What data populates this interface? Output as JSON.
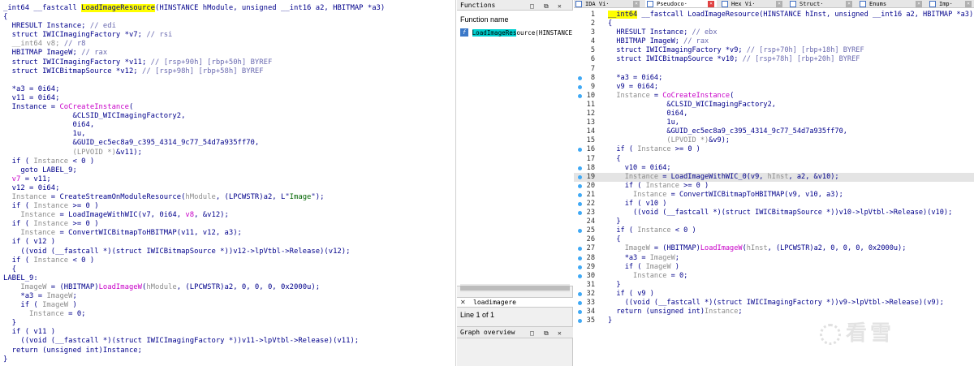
{
  "left": {
    "lines": [
      [
        [
          "kw",
          "_int64 __fastcall "
        ],
        [
          "hl-fn",
          "LoadImageResource"
        ],
        [
          "kw",
          "(HINSTANCE hModule, unsigned __int16 a2, HBITMAP *a3)"
        ]
      ],
      [
        [
          "kw",
          "{"
        ]
      ],
      [
        [
          "kw",
          "  HRESULT Instance; "
        ],
        [
          "cm",
          "// edi"
        ]
      ],
      [
        [
          "kw",
          "  struct IWICImagingFactory *v7; "
        ],
        [
          "cm",
          "// rsi"
        ]
      ],
      [
        [
          "gr",
          "  __int64 v8; "
        ],
        [
          "cm",
          "// r8"
        ]
      ],
      [
        [
          "kw",
          "  HBITMAP ImageW; "
        ],
        [
          "cm",
          "// rax"
        ]
      ],
      [
        [
          "kw",
          "  struct IWICImagingFactory *v11; "
        ],
        [
          "cm",
          "// [rsp+90h] [rbp+50h] BYREF"
        ]
      ],
      [
        [
          "kw",
          "  struct IWICBitmapSource *v12; "
        ],
        [
          "cm",
          "// [rsp+98h] [rbp+58h] BYREF"
        ]
      ],
      [
        [
          "kw",
          ""
        ]
      ],
      [
        [
          "kw",
          "  *a3 = 0i64;"
        ]
      ],
      [
        [
          "kw",
          "  v11 = 0i64;"
        ]
      ],
      [
        [
          "kw",
          "  Instance = "
        ],
        [
          "mg",
          "CoCreateInstance"
        ],
        [
          "kw",
          "("
        ]
      ],
      [
        [
          "kw",
          "                &CLSID_WICImagingFactory2,"
        ]
      ],
      [
        [
          "kw",
          "                0i64,"
        ]
      ],
      [
        [
          "kw",
          "                1u,"
        ]
      ],
      [
        [
          "kw",
          "                &GUID_ec5ec8a9_c395_4314_9c77_54d7a935ff70,"
        ]
      ],
      [
        [
          "gr",
          "                (LPVOID *)"
        ],
        [
          "kw",
          "&v11);"
        ]
      ],
      [
        [
          "kw",
          "  if ( "
        ],
        [
          "gr",
          "Instance"
        ],
        [
          "kw",
          " < 0 )"
        ]
      ],
      [
        [
          "kw",
          "    goto LABEL_9;"
        ]
      ],
      [
        [
          "mg",
          "  v7"
        ],
        [
          "kw",
          " = v11;"
        ]
      ],
      [
        [
          "kw",
          "  v12 = 0i64;"
        ]
      ],
      [
        [
          "gr",
          "  Instance"
        ],
        [
          "kw",
          " = CreateStreamOnModuleResource("
        ],
        [
          "gr",
          "hModule"
        ],
        [
          "kw",
          ", (LPCWSTR)a2, L\""
        ],
        [
          "gn",
          "Image"
        ],
        [
          "kw",
          "\");"
        ]
      ],
      [
        [
          "kw",
          "  if ( "
        ],
        [
          "gr",
          "Instance"
        ],
        [
          "kw",
          " >= 0 )"
        ]
      ],
      [
        [
          "gr",
          "    Instance"
        ],
        [
          "kw",
          " = LoadImageWithWIC(v7, 0i64, "
        ],
        [
          "mg",
          "v8"
        ],
        [
          "kw",
          ", &v12);"
        ]
      ],
      [
        [
          "kw",
          "  if ( "
        ],
        [
          "gr",
          "Instance"
        ],
        [
          "kw",
          " >= 0 )"
        ]
      ],
      [
        [
          "gr",
          "    Instance"
        ],
        [
          "kw",
          " = ConvertWICBitmapToHBITMAP(v11, v12, a3);"
        ]
      ],
      [
        [
          "kw",
          "  if ( v12 )"
        ]
      ],
      [
        [
          "kw",
          "    ((void (__fastcall *)(struct IWICBitmapSource *))v12->lpVtbl->Release)(v12);"
        ]
      ],
      [
        [
          "kw",
          "  if ( "
        ],
        [
          "gr",
          "Instance"
        ],
        [
          "kw",
          " < 0 )"
        ]
      ],
      [
        [
          "kw",
          "  {"
        ]
      ],
      [
        [
          "kw",
          "LABEL_9:"
        ]
      ],
      [
        [
          "gr",
          "    ImageW"
        ],
        [
          "kw",
          " = (HBITMAP)"
        ],
        [
          "mg",
          "LoadImageW"
        ],
        [
          "kw",
          "("
        ],
        [
          "gr",
          "hModule"
        ],
        [
          "kw",
          ", (LPCWSTR)a2, 0, 0, 0, 0x2000u);"
        ]
      ],
      [
        [
          "kw",
          "    *a3 = "
        ],
        [
          "gr",
          "ImageW"
        ],
        [
          "kw",
          ";"
        ]
      ],
      [
        [
          "kw",
          "    if ( "
        ],
        [
          "gr",
          "ImageW"
        ],
        [
          "kw",
          " )"
        ]
      ],
      [
        [
          "gr",
          "      Instance"
        ],
        [
          "kw",
          " = 0;"
        ]
      ],
      [
        [
          "kw",
          "  }"
        ]
      ],
      [
        [
          "kw",
          "  if ( v11 )"
        ]
      ],
      [
        [
          "kw",
          "    ((void (__fastcall *)(struct IWICImagingFactory *))v11->lpVtbl->Release)(v11);"
        ]
      ],
      [
        [
          "kw",
          "  return (unsigned int)Instance;"
        ]
      ],
      [
        [
          "kw",
          "}"
        ]
      ]
    ]
  },
  "middle": {
    "functions_title": "Functions",
    "column_header": "Function name",
    "function_item": "LoadImageResource(HINSTANCE",
    "function_hl": "LoadImageRes",
    "function_rest": "ource(HINSTANCE",
    "function_icon": "f",
    "search_value": "loadimagere",
    "search_clear": "✕",
    "line_info": "Line 1 of 1",
    "graph_title": "Graph overview"
  },
  "tabs": [
    {
      "label": "IDA Vi·",
      "active": false
    },
    {
      "label": "Pseudoco·",
      "active": true
    },
    {
      "label": "Hex Vi·",
      "active": false
    },
    {
      "label": "Struct·",
      "active": false
    },
    {
      "label": "Enums",
      "active": false
    },
    {
      "label": "Imp·",
      "active": false
    }
  ],
  "right": {
    "rows": [
      {
        "n": "1",
        "dot": false,
        "hl": false,
        "seg": [
          [
            "hl-fn",
            "__int64"
          ],
          [
            "kw",
            " __fastcall LoadImageResource(HINSTANCE hInst, unsigned __int16 a2, HBITMAP *a3)"
          ]
        ]
      },
      {
        "n": "2",
        "dot": false,
        "hl": false,
        "seg": [
          [
            "kw",
            "{"
          ]
        ]
      },
      {
        "n": "3",
        "dot": false,
        "hl": false,
        "seg": [
          [
            "kw",
            "  HRESULT Instance; "
          ],
          [
            "cm",
            "// ebx"
          ]
        ]
      },
      {
        "n": "4",
        "dot": false,
        "hl": false,
        "seg": [
          [
            "kw",
            "  HBITMAP ImageW; "
          ],
          [
            "cm",
            "// rax"
          ]
        ]
      },
      {
        "n": "5",
        "dot": false,
        "hl": false,
        "seg": [
          [
            "kw",
            "  struct IWICImagingFactory *v9; "
          ],
          [
            "cm",
            "// [rsp+70h] [rbp+18h] BYREF"
          ]
        ]
      },
      {
        "n": "6",
        "dot": false,
        "hl": false,
        "seg": [
          [
            "kw",
            "  struct IWICBitmapSource *v10; "
          ],
          [
            "cm",
            "// [rsp+78h] [rbp+20h] BYREF"
          ]
        ]
      },
      {
        "n": "7",
        "dot": false,
        "hl": false,
        "seg": [
          [
            "kw",
            ""
          ]
        ]
      },
      {
        "n": "8",
        "dot": true,
        "hl": false,
        "seg": [
          [
            "kw",
            "  *a3 = 0i64;"
          ]
        ]
      },
      {
        "n": "9",
        "dot": true,
        "hl": false,
        "seg": [
          [
            "kw",
            "  v9 = 0i64;"
          ]
        ]
      },
      {
        "n": "10",
        "dot": true,
        "hl": false,
        "seg": [
          [
            "gr",
            "  Instance"
          ],
          [
            "kw",
            " = "
          ],
          [
            "mg",
            "CoCreateInstance"
          ],
          [
            "kw",
            "("
          ]
        ]
      },
      {
        "n": "11",
        "dot": false,
        "hl": false,
        "seg": [
          [
            "kw",
            "              &CLSID_WICImagingFactory2,"
          ]
        ]
      },
      {
        "n": "12",
        "dot": false,
        "hl": false,
        "seg": [
          [
            "kw",
            "              0i64,"
          ]
        ]
      },
      {
        "n": "13",
        "dot": false,
        "hl": false,
        "seg": [
          [
            "kw",
            "              1u,"
          ]
        ]
      },
      {
        "n": "14",
        "dot": false,
        "hl": false,
        "seg": [
          [
            "kw",
            "              &GUID_ec5ec8a9_c395_4314_9c77_54d7a935ff70,"
          ]
        ]
      },
      {
        "n": "15",
        "dot": false,
        "hl": false,
        "seg": [
          [
            "gr",
            "              (LPVOID *)"
          ],
          [
            "kw",
            "&v9);"
          ]
        ]
      },
      {
        "n": "16",
        "dot": true,
        "hl": false,
        "seg": [
          [
            "kw",
            "  if ( "
          ],
          [
            "gr",
            "Instance"
          ],
          [
            "kw",
            " >= 0 )"
          ]
        ]
      },
      {
        "n": "17",
        "dot": false,
        "hl": false,
        "seg": [
          [
            "kw",
            "  {"
          ]
        ]
      },
      {
        "n": "18",
        "dot": true,
        "hl": false,
        "seg": [
          [
            "kw",
            "    v10 = 0i64;"
          ]
        ]
      },
      {
        "n": "19",
        "dot": true,
        "hl": true,
        "seg": [
          [
            "gr",
            "    Instance"
          ],
          [
            "kw",
            " = LoadImageWithWIC_0(v9, "
          ],
          [
            "gr",
            "hInst"
          ],
          [
            "kw",
            ", a2, &v10);"
          ]
        ]
      },
      {
        "n": "20",
        "dot": true,
        "hl": false,
        "seg": [
          [
            "kw",
            "    if ( "
          ],
          [
            "gr",
            "Instance"
          ],
          [
            "kw",
            " >= 0 )"
          ]
        ]
      },
      {
        "n": "21",
        "dot": true,
        "hl": false,
        "seg": [
          [
            "gr",
            "      Instance"
          ],
          [
            "kw",
            " = ConvertWICBitmapToHBITMAP(v9, v10, a3);"
          ]
        ]
      },
      {
        "n": "22",
        "dot": true,
        "hl": false,
        "seg": [
          [
            "kw",
            "    if ( v10 )"
          ]
        ]
      },
      {
        "n": "23",
        "dot": true,
        "hl": false,
        "seg": [
          [
            "kw",
            "      ((void (__fastcall *)(struct IWICBitmapSource *))v10->lpVtbl->Release)(v10);"
          ]
        ]
      },
      {
        "n": "24",
        "dot": false,
        "hl": false,
        "seg": [
          [
            "kw",
            "  }"
          ]
        ]
      },
      {
        "n": "25",
        "dot": true,
        "hl": false,
        "seg": [
          [
            "kw",
            "  if ( "
          ],
          [
            "gr",
            "Instance"
          ],
          [
            "kw",
            " < 0 )"
          ]
        ]
      },
      {
        "n": "26",
        "dot": false,
        "hl": false,
        "seg": [
          [
            "kw",
            "  {"
          ]
        ]
      },
      {
        "n": "27",
        "dot": true,
        "hl": false,
        "seg": [
          [
            "gr",
            "    ImageW"
          ],
          [
            "kw",
            " = (HBITMAP)"
          ],
          [
            "mg",
            "LoadImageW"
          ],
          [
            "kw",
            "("
          ],
          [
            "gr",
            "hInst"
          ],
          [
            "kw",
            ", (LPCWSTR)a2, 0, 0, 0, 0x2000u);"
          ]
        ]
      },
      {
        "n": "28",
        "dot": true,
        "hl": false,
        "seg": [
          [
            "kw",
            "    *a3 = "
          ],
          [
            "gr",
            "ImageW"
          ],
          [
            "kw",
            ";"
          ]
        ]
      },
      {
        "n": "29",
        "dot": true,
        "hl": false,
        "seg": [
          [
            "kw",
            "    if ( "
          ],
          [
            "gr",
            "ImageW"
          ],
          [
            "kw",
            " )"
          ]
        ]
      },
      {
        "n": "30",
        "dot": true,
        "hl": false,
        "seg": [
          [
            "gr",
            "      Instance"
          ],
          [
            "kw",
            " = 0;"
          ]
        ]
      },
      {
        "n": "31",
        "dot": false,
        "hl": false,
        "seg": [
          [
            "kw",
            "  }"
          ]
        ]
      },
      {
        "n": "32",
        "dot": true,
        "hl": false,
        "seg": [
          [
            "kw",
            "  if ( v9 )"
          ]
        ]
      },
      {
        "n": "33",
        "dot": true,
        "hl": false,
        "seg": [
          [
            "kw",
            "    ((void (__fastcall *)(struct IWICImagingFactory *))v9->lpVtbl->Release)(v9);"
          ]
        ]
      },
      {
        "n": "34",
        "dot": true,
        "hl": false,
        "seg": [
          [
            "kw",
            "  return (unsigned int)"
          ],
          [
            "gr",
            "Instance"
          ],
          [
            "kw",
            ";"
          ]
        ]
      },
      {
        "n": "35",
        "dot": true,
        "hl": false,
        "seg": [
          [
            "kw",
            "}"
          ]
        ]
      }
    ]
  },
  "watermark": "看雪",
  "colors": {
    "accent_dot": "#3fa9f5",
    "highlight_yellow": "#ffff00",
    "highlight_cyan": "#00d0d0"
  }
}
